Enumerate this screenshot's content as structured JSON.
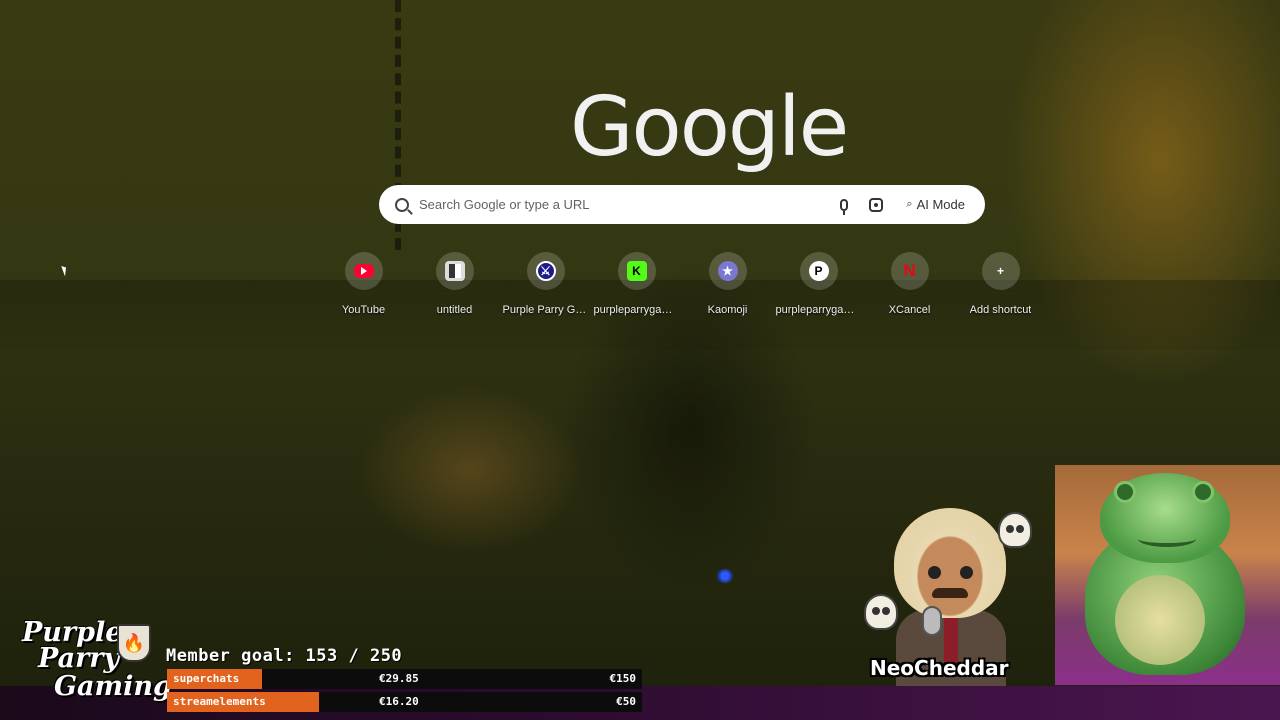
{
  "google": {
    "logo_text": "Google",
    "search": {
      "placeholder": "Search Google or type a URL",
      "ai_mode_label": "AI Mode"
    },
    "shortcuts": [
      {
        "label": "YouTube",
        "icon": "youtube-icon"
      },
      {
        "label": "untitled",
        "icon": "document-icon"
      },
      {
        "label": "Purple Parry Ga...",
        "icon": "purple-parry-icon"
      },
      {
        "label": "purpleparrygam...",
        "icon": "kick-icon",
        "glyph": "K"
      },
      {
        "label": "Kaomoji",
        "icon": "kaomoji-icon",
        "glyph": "★"
      },
      {
        "label": "purpleparrygam...",
        "icon": "patreon-icon",
        "glyph": "P"
      },
      {
        "label": "XCancel",
        "icon": "xcancel-icon",
        "glyph": "N"
      },
      {
        "label": "Add shortcut",
        "icon": "plus-icon",
        "glyph": "+"
      }
    ]
  },
  "overlay": {
    "channel_logo": {
      "line1": "Purple",
      "line2": "Parry",
      "line3": "Gaming"
    },
    "member_goal": "Member goal: 153 / 250",
    "member_goal_current": 153,
    "member_goal_target": 250,
    "donation_bars": [
      {
        "name": "superchats",
        "current": "€29.85",
        "target": "€150",
        "progress": 0.2
      },
      {
        "name": "streamelements",
        "current": "€16.20",
        "target": "€50",
        "progress": 0.32
      }
    ],
    "avatar_name": "NeoCheddar",
    "colors": {
      "bar_fill": "#e2631e",
      "bar_bg": "#0c0c0c"
    }
  }
}
